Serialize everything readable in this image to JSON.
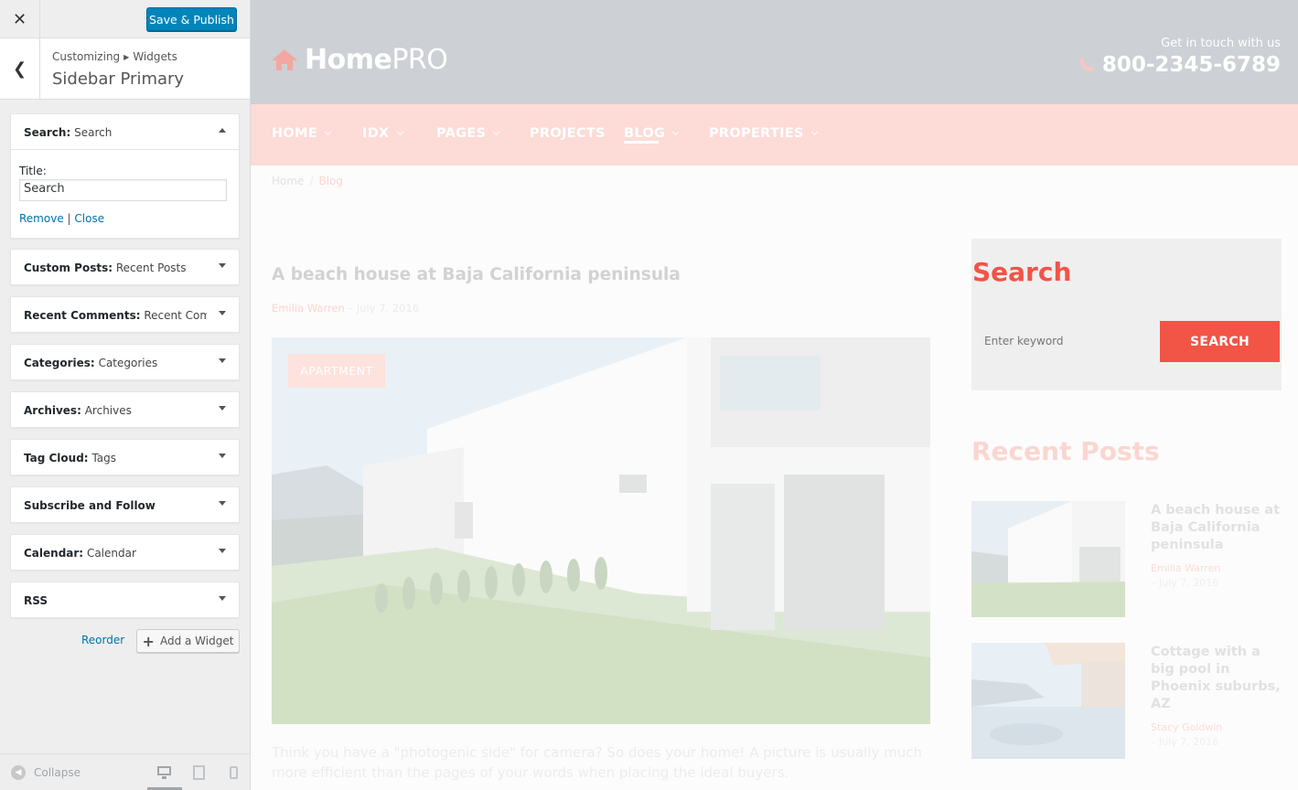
{
  "customizer": {
    "close_icon": "close-icon",
    "save_label": "Save & Publish",
    "breadcrumb_root": "Customizing",
    "breadcrumb_child": "Widgets",
    "section_title": "Sidebar Primary",
    "expanded_widget": {
      "type": "Search:",
      "name": "Search",
      "field_label": "Title:",
      "field_value": "Search",
      "remove_label": "Remove",
      "separator": "|",
      "close_label": "Close"
    },
    "widgets": [
      {
        "type": "Custom Posts:",
        "name": "Recent Posts"
      },
      {
        "type": "Recent Comments:",
        "name": "Recent Com..."
      },
      {
        "type": "Categories:",
        "name": "Categories"
      },
      {
        "type": "Archives:",
        "name": "Archives"
      },
      {
        "type": "Tag Cloud:",
        "name": "Tags"
      },
      {
        "type": "Subscribe and Follow",
        "name": ""
      },
      {
        "type": "Calendar:",
        "name": "Calendar"
      },
      {
        "type": "RSS",
        "name": ""
      }
    ],
    "reorder_label": "Reorder",
    "add_widget_label": "Add a Widget",
    "collapse_label": "Collapse",
    "accent_color": "#0085ba",
    "link_color": "#0073aa"
  },
  "site": {
    "logo_bold": "Home",
    "logo_light": "PRO",
    "contact_line": "Get in touch with us",
    "phone": "800-2345-6789",
    "nav": [
      {
        "label": "HOME",
        "has_caret": true
      },
      {
        "label": "IDX",
        "has_caret": true
      },
      {
        "label": "PAGES",
        "has_caret": true
      },
      {
        "label": "PROJECTS",
        "has_caret": false
      },
      {
        "label": "BLOG",
        "has_caret": true,
        "active": true
      },
      {
        "label": "PROPERTIES",
        "has_caret": true
      }
    ],
    "breadcrumb": {
      "home": "Home",
      "separator": "/",
      "current": "Blog"
    },
    "post": {
      "title": "A beach house at Baja California peninsula",
      "author": "Emilia Warren",
      "date_sep": "–",
      "date": "July 7, 2016",
      "tag": "APARTMENT",
      "excerpt": "Think you have a \"photogenic side\" for camera? So does your home! A picture is usually much more efficient than the pages of your words when placing the ideal buyers."
    },
    "search_widget": {
      "title": "Search",
      "placeholder": "Enter keyword",
      "button_label": "SEARCH"
    },
    "recent_posts": {
      "title": "Recent Posts",
      "items": [
        {
          "title": "A beach house at Baja California peninsula",
          "author": "Emilia Warren",
          "date": "– July 7, 2016"
        },
        {
          "title": "Cottage with a big pool in Phoenix suburbs, AZ",
          "author": "Stacy Goldwin",
          "date": "– July 7, 2016"
        }
      ]
    },
    "brand_color": "#f25446"
  }
}
